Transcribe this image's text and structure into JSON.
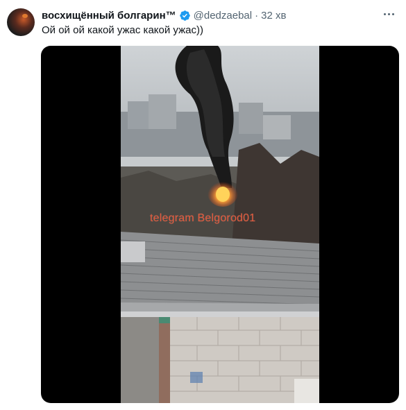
{
  "tweet": {
    "display_name": "восхищённый болгарин™",
    "verified_icon": "verified-badge-icon",
    "handle": "@dedzaebal",
    "separator": "·",
    "time": "32 хв",
    "text": "Ой ой ой какой ужас какой ужас))",
    "more_icon": "more-dots-icon"
  },
  "media": {
    "watermark": "telegram Belgorod01",
    "watermark_color": "#e4583a",
    "background": "#000000"
  },
  "colors": {
    "text": "#0f1419",
    "secondary": "#536471",
    "verified": "#1d9bf0"
  }
}
